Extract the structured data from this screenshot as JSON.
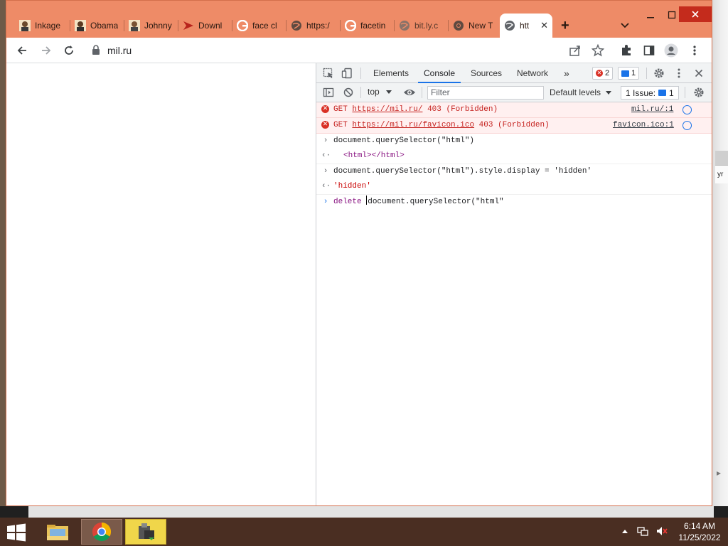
{
  "window": {
    "tabs": [
      {
        "title": "Inkage",
        "icon": "portrait-favicon"
      },
      {
        "title": "Obama",
        "icon": "portrait-favicon"
      },
      {
        "title": "Johnny",
        "icon": "portrait-favicon"
      },
      {
        "title": "Downl",
        "icon": "red-arrow-favicon"
      },
      {
        "title": "face cl",
        "icon": "google-favicon"
      },
      {
        "title": "https:/",
        "icon": "globe-favicon"
      },
      {
        "title": "facetin",
        "icon": "google-favicon"
      },
      {
        "title": "bit.ly.c",
        "icon": "globe-favicon"
      },
      {
        "title": "New T",
        "icon": "chrome-favicon"
      },
      {
        "title": "htt",
        "icon": "globe-favicon",
        "active": true
      }
    ],
    "new_tab": "+",
    "close_tab": "✕"
  },
  "toolbar": {
    "url": "mil.ru"
  },
  "devtools": {
    "tabs": {
      "elements": "Elements",
      "console": "Console",
      "sources": "Sources",
      "network": "Network",
      "more": "»"
    },
    "error_count": "2",
    "message_count": "1",
    "context": "top",
    "filter_placeholder": "Filter",
    "levels": "Default levels",
    "issues_label": "1 Issue:",
    "issues_count": "1",
    "console": {
      "errors": [
        {
          "method": "GET",
          "url": "https://mil.ru/",
          "status": "403 (Forbidden)",
          "source": "mil.ru/:1"
        },
        {
          "method": "GET",
          "url": "https://mil.ru/favicon.ico",
          "status": "403 (Forbidden)",
          "source": "favicon.ico:1"
        }
      ],
      "cmd1": "document.querySelector(\"html\")",
      "res1": "<html></html>",
      "cmd2_prefix": "document.querySelector(\"html\").style.display = ",
      "cmd2_str": "'hidden'",
      "res2": "'hidden'",
      "cmd3_kw": "delete",
      "cmd3_rest": "document.querySelector(\"html\""
    }
  },
  "taskbar": {
    "time": "6:14 AM",
    "date": "11/25/2022"
  },
  "desktop": {
    "edge_text": "yr"
  },
  "colors": {
    "titlebar": "#ee8b67",
    "close": "#c42b1c",
    "accent": "#1a73e8",
    "error_bg": "#fff0f0",
    "taskbar": "#4a2e22"
  }
}
